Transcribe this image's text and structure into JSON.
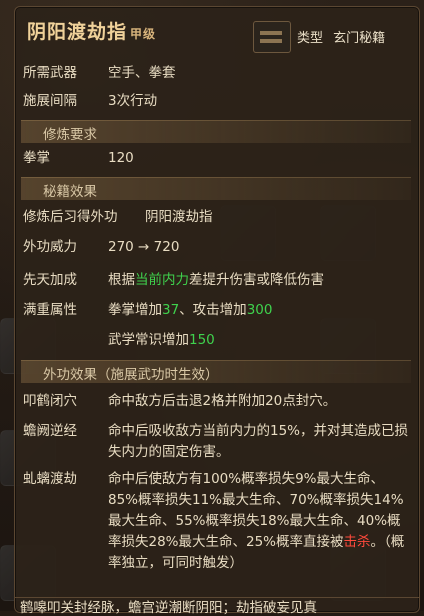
{
  "header": {
    "title": "阴阳渡劫指",
    "grade": "甲级",
    "type_label": "类型",
    "type_value": "玄门秘籍"
  },
  "attributes": [
    {
      "key": "所需武器",
      "value": "空手、拳套"
    },
    {
      "key": "施展间隔",
      "value": "3次行动"
    }
  ],
  "cultivation": {
    "section_title": "修炼要求",
    "key": "拳掌",
    "value": "120"
  },
  "secret_effects": {
    "section_title": "秘籍效果",
    "learn_key": "修炼后习得外功",
    "learn_value": "阴阳渡劫指",
    "power_key": "外功威力",
    "power_value": "270 → 720",
    "innate_key": "先天加成",
    "innate_text_pre": "根据",
    "innate_text_highlight": "当前内力",
    "innate_text_post": "差提升伤害或降低伤害",
    "full_key": "满重属性",
    "full_line1_a": "拳掌增加",
    "full_line1_a_val": "37",
    "full_line1_b": "、攻击增加",
    "full_line1_b_val": "300",
    "full_line2_a": "武学常识增加",
    "full_line2_a_val": "150"
  },
  "external_effects": {
    "section_title": "外功效果（施展武功时生效）",
    "e1_key": "叩鹤闭穴",
    "e1_text": "命中敌方后击退2格并附加20点封穴。",
    "e2_key": "蟾阙逆经",
    "e2_text": "命中后吸收敌方当前内力的15%，并对其造成已损失内力的固定伤害。",
    "e3_key": "虬螭渡劫",
    "e3_text_pre": "命中后使敌方有100%概率损失9%最大生命、85%概率损失11%最大生命、70%概率损失14%最大生命、55%概率损失18%最大生命、40%概率损失28%最大生命、25%概率直接被",
    "e3_text_highlight": "击杀",
    "e3_text_post": "。（概率独立，可同时触发）"
  },
  "footer": {
    "text": "鹤嗥叩关封经脉，蟾宫逆潮断阴阳；劫指破妄见真"
  },
  "colors": {
    "accent_green": "#3fd24d",
    "accent_red": "#ff4a3c",
    "title": "#f0d29a"
  },
  "icons": [
    "type-icon"
  ]
}
